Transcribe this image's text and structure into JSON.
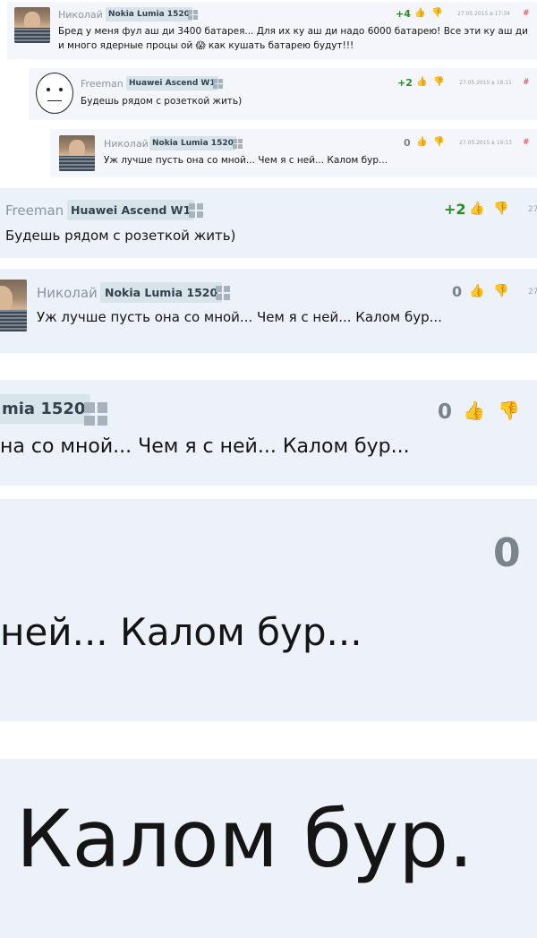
{
  "comments": {
    "c1": {
      "author": "Николай",
      "device": "Nokia Lumia 1520",
      "score": "+4",
      "date": "27.05.2015 в 17:34",
      "hash": "#",
      "text_line1": "Бред у меня фул аш ди 3400 батарея... Для их ку аш ди надо 6000 батарею! Все эти ку аш ди",
      "text_line2": "и много ядерные процы ой 😱 как кушать батарею будут!!!"
    },
    "c2": {
      "author": "Freeman",
      "device": "Huawei Ascend W1",
      "score": "+2",
      "date": "27.05.2015 в 18:11",
      "hash": "#",
      "text": "Будешь рядом с розеткой жить)"
    },
    "c3": {
      "author": "Николай",
      "device": "Nokia Lumia 1520",
      "score": "0",
      "date": "27.05.2015 в 19:13",
      "hash": "#",
      "text": "Уж лучше пусть она со мной... Чем я с ней... Калом бур..."
    }
  },
  "zoom1": {
    "author": "Freeman",
    "device": "Huawei Ascend W1",
    "score": "+2",
    "date_fragment": "27",
    "text": "Будешь рядом с розеткой жить)"
  },
  "zoom2": {
    "author": "Николай",
    "device": "Nokia Lumia 1520",
    "score": "0",
    "date_fragment": "27",
    "text": "Уж лучше пусть она со мной... Чем я с ней... Калом бур..."
  },
  "zoom3": {
    "device_fragment": "mia 1520",
    "score": "0",
    "text_fragment": "на со мной... Чем я с ней... Калом бур..."
  },
  "zoom4": {
    "score": "0",
    "text_fragment": "ней... Калом бур..."
  },
  "zoom5": {
    "text_fragment": "Калом бур."
  },
  "icons": {
    "like": "👍",
    "dislike": "👎"
  }
}
